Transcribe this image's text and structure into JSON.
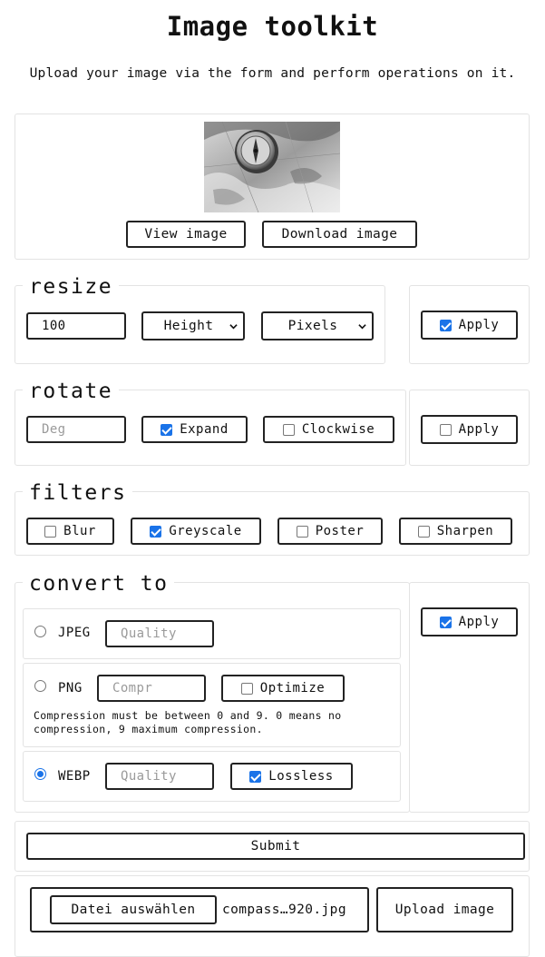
{
  "page": {
    "title": "Image toolkit",
    "subtitle": "Upload your image via the form and perform operations on it."
  },
  "preview": {
    "image_alt": "compass on map",
    "view_label": "View image",
    "download_label": "Download image"
  },
  "resize": {
    "legend": "resize",
    "value": "100",
    "dimension_selected": "Height",
    "unit_selected": "Pixels",
    "apply_label": "Apply",
    "apply_checked": true
  },
  "rotate": {
    "legend": "rotate",
    "degrees_placeholder": "Deg",
    "expand_label": "Expand",
    "expand_checked": true,
    "clockwise_label": "Clockwise",
    "clockwise_checked": false,
    "apply_label": "Apply",
    "apply_checked": false
  },
  "filters": {
    "legend": "filters",
    "items": [
      {
        "label": "Blur",
        "checked": false
      },
      {
        "label": "Greyscale",
        "checked": true
      },
      {
        "label": "Poster",
        "checked": false
      },
      {
        "label": "Sharpen",
        "checked": false
      }
    ]
  },
  "convert": {
    "legend": "convert to",
    "jpeg": {
      "label": "JPEG",
      "selected": false,
      "quality_placeholder": "Quality"
    },
    "png": {
      "label": "PNG",
      "selected": false,
      "compression_placeholder": "Compr",
      "optimize_label": "Optimize",
      "optimize_checked": false,
      "note": "Compression must be between 0 and 9. 0 means no compression, 9 maximum compression."
    },
    "webp": {
      "label": "WEBP",
      "selected": true,
      "quality_placeholder": "Quality",
      "lossless_label": "Lossless",
      "lossless_checked": true
    },
    "apply_label": "Apply",
    "apply_checked": true
  },
  "submit_label": "Submit",
  "upload": {
    "choose_label": "Datei auswählen",
    "file_name": "compass…920.jpg",
    "upload_label": "Upload image"
  },
  "colors": {
    "accent": "#1a73e8",
    "border": "#222222"
  }
}
